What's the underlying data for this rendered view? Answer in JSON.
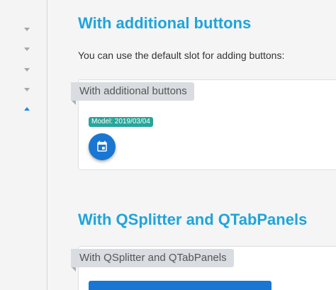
{
  "sidebar": {
    "items": [
      {
        "icon": "chevron-down-icon"
      },
      {
        "icon": "chevron-down-icon"
      },
      {
        "icon": "chevron-down-icon"
      },
      {
        "icon": "chevron-down-icon"
      },
      {
        "icon": "chevron-up-icon",
        "expanded": true
      }
    ]
  },
  "section1": {
    "title": "With additional buttons",
    "description": "You can use the default slot for adding buttons:",
    "card_header": "With additional buttons",
    "model_badge": "Model: 2019/03/04",
    "event_button_icon": "event-icon"
  },
  "section2": {
    "title": "With QSplitter and QTabPanels",
    "card_header": "With QSplitter and QTabPanels"
  },
  "colors": {
    "heading": "#1fa4dc",
    "primary": "#1976d2",
    "badge": "#26a69a",
    "header_bg": "#d9dde1"
  }
}
